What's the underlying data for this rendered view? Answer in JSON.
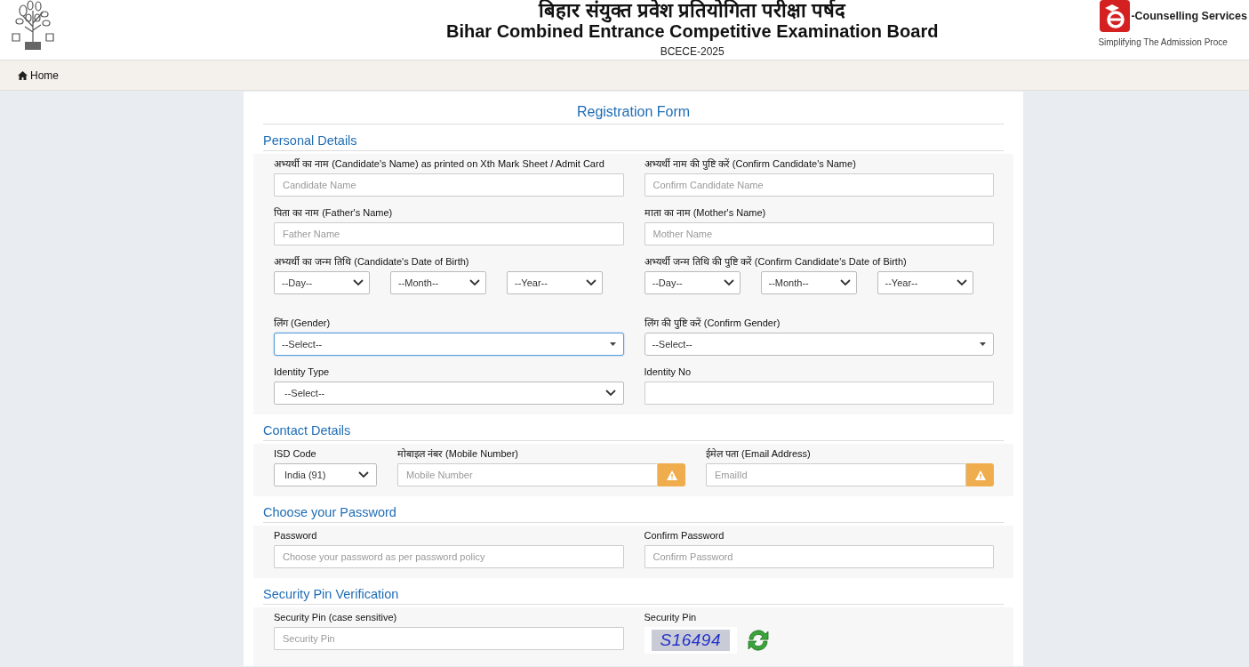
{
  "header": {
    "title_hindi": "बिहार संयुक्त प्रवेश प्रतियोगिता परीक्षा पर्षद",
    "title_english": "Bihar Combined Entrance Competitive Examination Board",
    "subtitle": "BCECE-2025",
    "brand": {
      "name": "-Counselling Services",
      "tagline": "Simplifying The Admission Proce"
    }
  },
  "nav": [
    {
      "label": "Home"
    }
  ],
  "form": {
    "title": "Registration Form",
    "sections": [
      {
        "title": "Personal Details",
        "rows": [
          {
            "fields": [
              {
                "kind": "text",
                "label": "अभ्यर्थी का नाम (Candidate's Name) as printed on Xth Mark Sheet / Admit Card",
                "placeholder": "Candidate Name"
              },
              {
                "kind": "text",
                "label": "अभ्यर्थी नाम की पुष्टि करें (Confirm Candidate's Name)",
                "placeholder": "Confirm Candidate Name"
              }
            ]
          },
          {
            "fields": [
              {
                "kind": "text",
                "label": "पिता का नाम (Father's Name)",
                "placeholder": "Father Name"
              },
              {
                "kind": "text",
                "label": "माता का नाम (Mother's Name)",
                "placeholder": "Mother Name"
              }
            ]
          },
          {
            "fields": [
              {
                "kind": "date",
                "label": "अभ्यर्थी का जन्म तिथि (Candidate's Date of Birth)",
                "parts": [
                  "--Day--",
                  "--Month--",
                  "--Year--"
                ]
              },
              {
                "kind": "date",
                "label": "अभ्यर्थी जन्म तिथि की पुष्टि करें (Confirm Candidate's Date of Birth)",
                "parts": [
                  "--Day--",
                  "--Month--",
                  "--Year--"
                ]
              }
            ]
          },
          {
            "fields": [
              {
                "kind": "combo",
                "label": "लिंग (Gender)",
                "value": "--Select--",
                "focused": true
              },
              {
                "kind": "combo",
                "label": "लिंग की पुष्टि करें (Confirm Gender)",
                "value": "--Select--",
                "focused": false
              }
            ]
          },
          {
            "fields": [
              {
                "kind": "select",
                "label": "Identity Type",
                "value": "--Select--"
              },
              {
                "kind": "text",
                "label": "Identity No"
              }
            ]
          }
        ]
      },
      {
        "title": "Contact Details",
        "rows": [
          {
            "fields": [
              {
                "kind": "select",
                "label": "ISD Code",
                "value": "India (91)"
              },
              {
                "kind": "text",
                "label": "मोबाइल नंबर (Mobile Number)",
                "placeholder": "Mobile Number",
                "warning": true
              },
              {
                "kind": "text",
                "label": "ईमेल पता (Email Address)",
                "placeholder": "EmailId",
                "warning": true
              }
            ]
          }
        ]
      },
      {
        "title": "Choose your Password",
        "rows": [
          {
            "fields": [
              {
                "kind": "text",
                "label": "Password",
                "placeholder": "Choose your password as per password policy"
              },
              {
                "kind": "text",
                "label": "Confirm Password",
                "placeholder": "Confirm Password"
              }
            ]
          }
        ]
      },
      {
        "title": "Security Pin Verification",
        "rows": [
          {
            "fields": [
              {
                "kind": "text",
                "label": "Security Pin (case sensitive)",
                "placeholder": "Security Pin"
              },
              {
                "kind": "captcha",
                "label": "Security Pin",
                "code": "S16494"
              }
            ]
          }
        ]
      }
    ]
  }
}
